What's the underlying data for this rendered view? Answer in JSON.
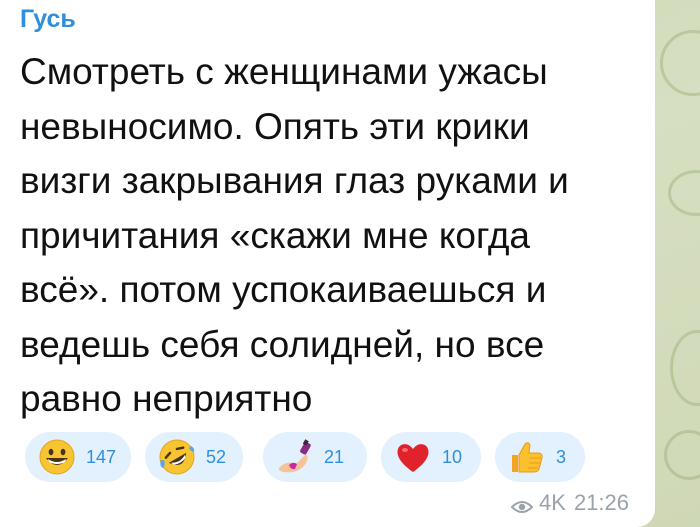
{
  "message": {
    "sender": "Гусь",
    "lines": [
      "Смотреть с женщинами ужасы",
      "невыносимо. Опять эти крики",
      "визги закрывания глаз руками и",
      "причитания «скажи мне когда",
      "всё». потом успокаиваешься и",
      "ведешь себя солидней, но все",
      "равно неприятно"
    ],
    "views": "4K",
    "time": "21:26"
  },
  "reactions": [
    {
      "emoji": "grinning-face-icon",
      "count": "147"
    },
    {
      "emoji": "rolling-on-floor-laughing-icon",
      "count": "52"
    },
    {
      "emoji": "nail-polish-icon",
      "count": "21"
    },
    {
      "emoji": "red-heart-icon",
      "count": "10"
    },
    {
      "emoji": "thumbs-up-icon",
      "count": "3"
    }
  ],
  "colors": {
    "sender": "#2f8fdd",
    "reaction_bg": "#e3f0fd",
    "reaction_count": "#2f8fdd",
    "meta": "#9aa3ad"
  }
}
